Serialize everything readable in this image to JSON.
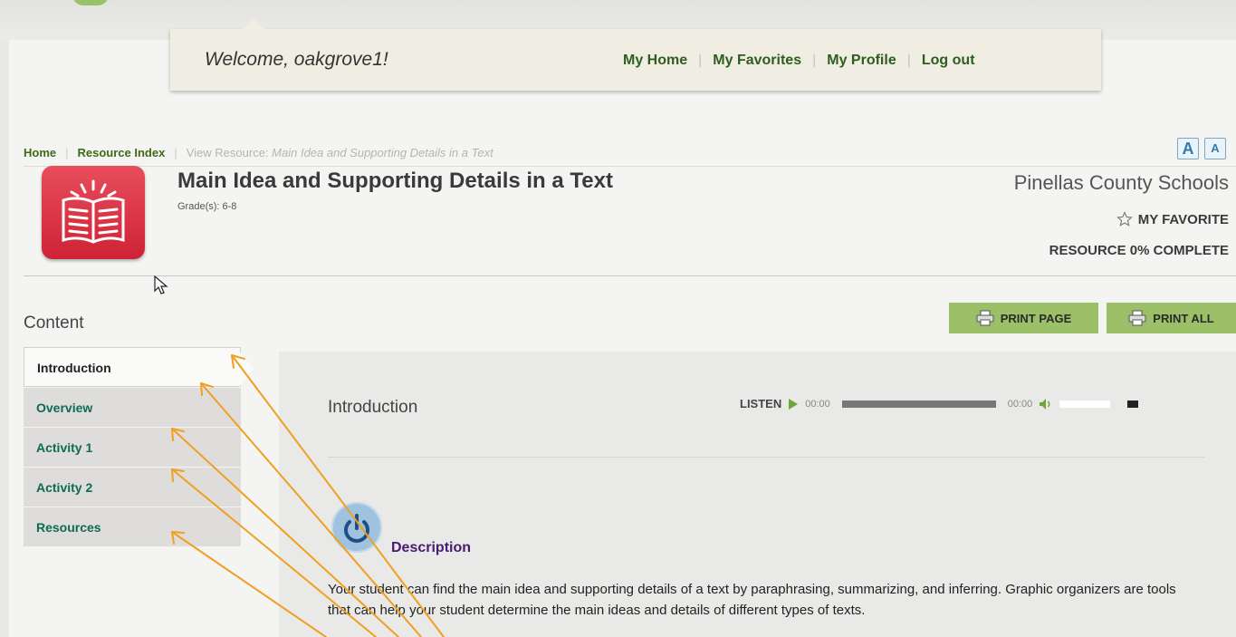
{
  "header": {
    "welcome": "Welcome, oakgrove1!",
    "links": [
      "My Home",
      "My Favorites",
      "My Profile",
      "Log out"
    ]
  },
  "breadcrumb": {
    "home": "Home",
    "index": "Resource Index",
    "current_prefix": "View Resource:",
    "current_title": "Main Idea and Supporting Details in a Text"
  },
  "font_controls": {
    "increase": "A",
    "decrease": "A"
  },
  "resource": {
    "title": "Main Idea and Supporting Details in a Text",
    "grade": "Grade(s): 6-8",
    "district": "Pinellas County Schools",
    "favorite": "MY FAVORITE",
    "progress": "RESOURCE 0% COMPLETE",
    "progress_value": 0
  },
  "content": {
    "heading": "Content",
    "print_page": "PRINT PAGE",
    "print_all": "PRINT ALL",
    "nav": [
      "Introduction",
      "Overview",
      "Activity 1",
      "Activity 2",
      "Resources"
    ],
    "active_nav": "Introduction"
  },
  "panel": {
    "title": "Introduction",
    "listen": "LISTEN",
    "time_start": "00:00",
    "time_end": "00:00",
    "description_heading": "Description",
    "description": "Your student can find the main idea and supporting details of a text by paraphrasing, summarizing, and inferring. Graphic organizers are tools that can help your student determine the main ideas and details of different types of texts."
  },
  "colors": {
    "link_green": "#3e6a17",
    "nav_teal": "#0f6a53",
    "print_green": "#9cc067",
    "resource_red": "#d62b40",
    "annotation_orange": "#f0a020"
  }
}
